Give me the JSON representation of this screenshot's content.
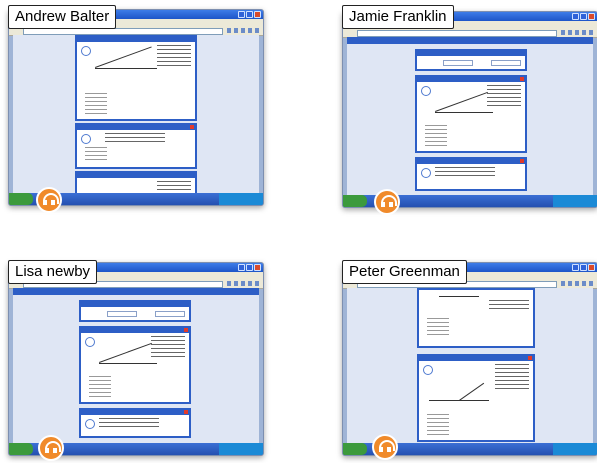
{
  "participants": [
    {
      "name": "Andrew Balter"
    },
    {
      "name": "Jamie Franklin"
    },
    {
      "name": "Lisa newby"
    },
    {
      "name": "Peter Greenman"
    }
  ],
  "icons": {
    "audio": "headset-icon"
  },
  "colors": {
    "audio_badge": "#f08a2a",
    "xp_titlebar": "#245edb",
    "card_border": "#2d5ec6"
  }
}
